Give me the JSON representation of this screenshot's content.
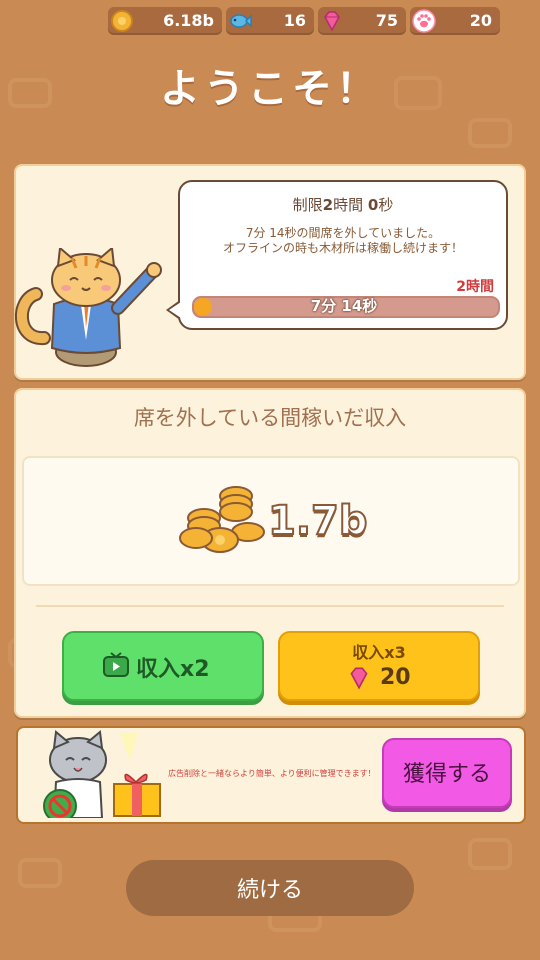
{
  "resources": [
    {
      "icon": "coin-icon",
      "value": "6.18b"
    },
    {
      "icon": "fish-icon",
      "value": "16"
    },
    {
      "icon": "gem-icon",
      "value": "75"
    },
    {
      "icon": "paw-icon",
      "value": "20"
    }
  ],
  "title": "ようこそ！",
  "offline": {
    "limit_prefix": "制限",
    "limit_hours": "2",
    "limit_hours_unit": "時間",
    "limit_seconds": "0",
    "limit_seconds_unit": "秒",
    "away_line": "7分 14秒の間席を外していました。",
    "working_line": "オフラインの時も木材所は稼働し続けます！",
    "max_label": "2時間",
    "elapsed_label": "7分 14秒",
    "progress_fraction": 0.06
  },
  "earnings": {
    "heading": "席を外している間稼いだ収入",
    "amount": "1.7b"
  },
  "buttons": {
    "double_label": "収入x2",
    "triple_label": "収入x3",
    "triple_cost": "20",
    "obtain_label": "獲得する",
    "continue_label": "続ける"
  },
  "promo": {
    "text": "広告削除と一緒ならより簡単、より便利に管理できます！"
  },
  "colors": {
    "background": "#c98a53",
    "green_button": "#5fe06a",
    "yellow_button": "#ffc21a",
    "pink_button": "#f25ae6",
    "progress_fill": "#f5a623"
  }
}
